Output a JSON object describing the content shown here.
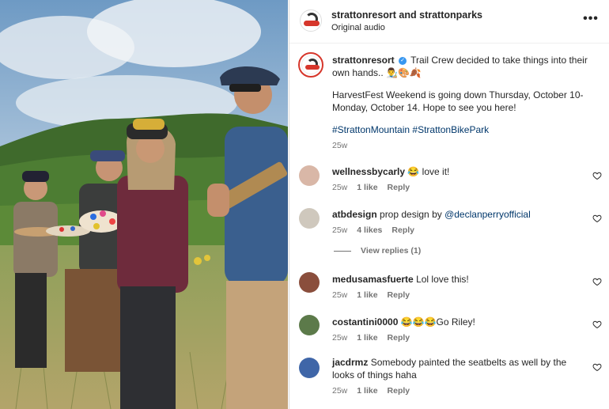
{
  "header": {
    "title": "strattonresort and strattonparks",
    "subtitle": "Original audio",
    "more_label": "•••"
  },
  "caption": {
    "username": "strattonresort",
    "text": "Trail Crew decided to take things into their own hands.. 👨‍🎨🎨🍂",
    "para2": "HarvestFest Weekend is going down Thursday, October 10-Monday, October 14. Hope to see you here!",
    "hashtags": "#StrattonMountain #StrattonBikePark",
    "time": "25w"
  },
  "comments": [
    {
      "username": "wellnessbycarly",
      "text": "😂 love it!",
      "time": "25w",
      "likes": "1 like",
      "reply": "Reply"
    },
    {
      "username": "atbdesign",
      "text_prefix": "prop design by ",
      "mention": "@declanperryofficial",
      "time": "25w",
      "likes": "4 likes",
      "reply": "Reply",
      "view_replies": "View replies (1)"
    },
    {
      "username": "medusamasfuerte",
      "text": "Lol love this!",
      "time": "25w",
      "likes": "1 like",
      "reply": "Reply"
    },
    {
      "username": "costantini0000",
      "text": "😂😂😂Go Riley!",
      "time": "25w",
      "likes": "1 like",
      "reply": "Reply"
    },
    {
      "username": "jacdrmz",
      "text": "Somebody painted the seatbelts as well by the looks of things haha",
      "time": "25w",
      "likes": "1 like",
      "reply": "Reply"
    }
  ],
  "colors": {
    "brand_red": "#d6362b",
    "link": "#00376b",
    "verified": "#3897f0",
    "meta": "#737373"
  },
  "icons": {
    "more": "more-options-icon",
    "heart": "heart-icon",
    "verified": "verified-badge-icon"
  }
}
